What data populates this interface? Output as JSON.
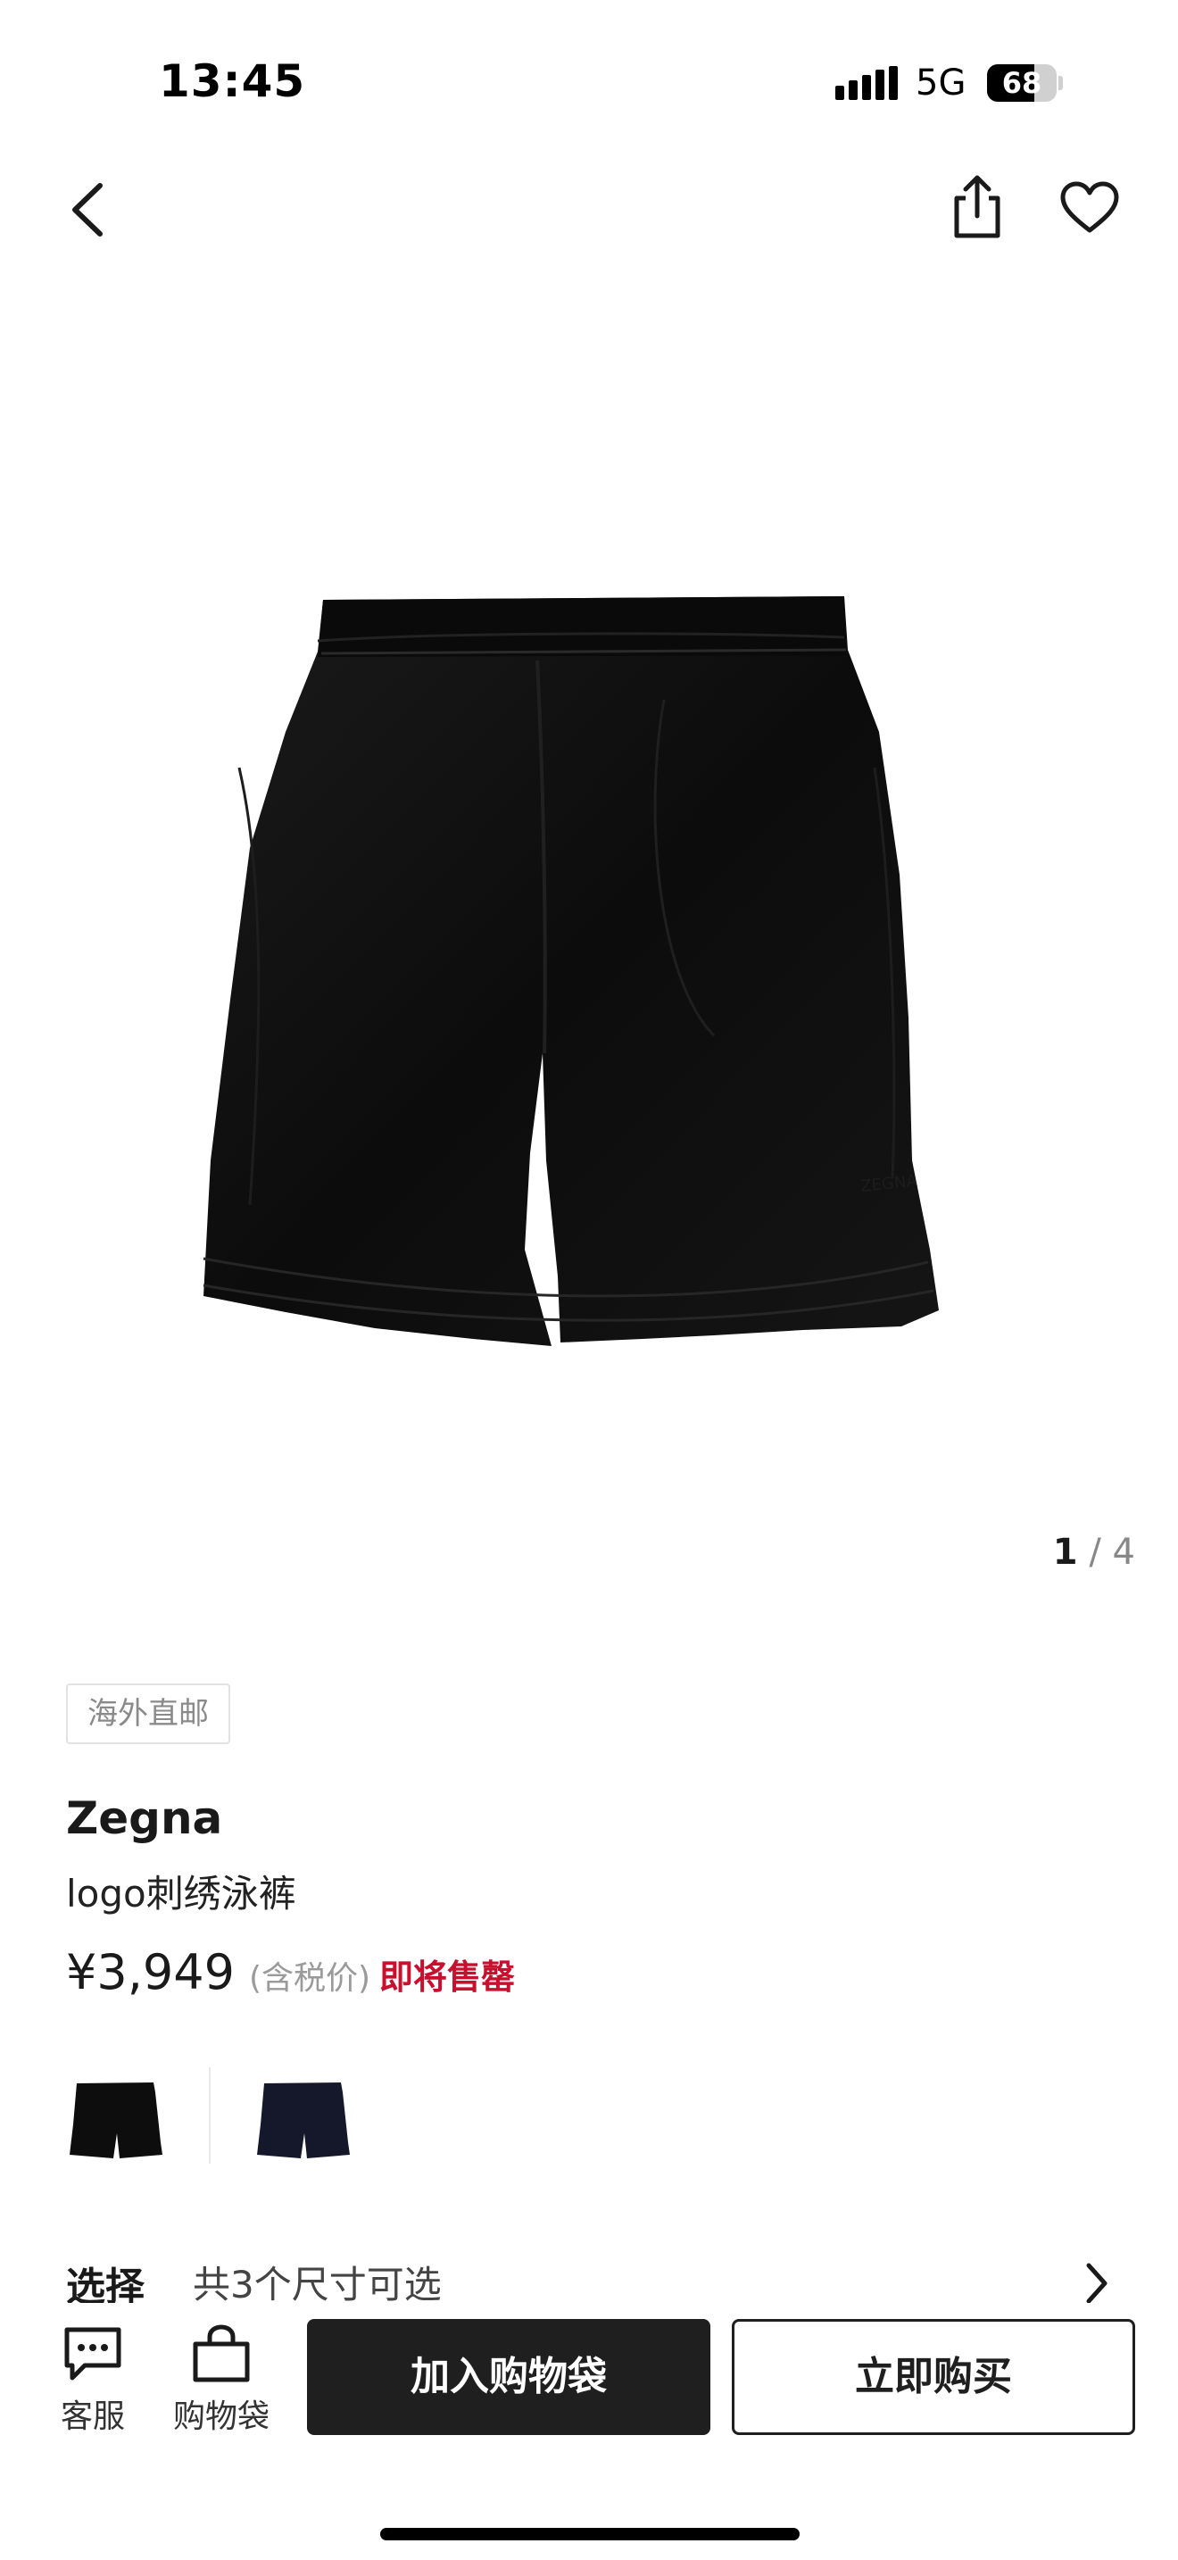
{
  "status_bar": {
    "time": "13:45",
    "network": "5G",
    "battery_level": "68"
  },
  "nav": {
    "back_icon": "chevron-left-icon",
    "share_icon": "share-icon",
    "favorite_icon": "heart-icon"
  },
  "gallery": {
    "image_subject": "black swim shorts",
    "current": "1",
    "separator": "/",
    "total": "4"
  },
  "product": {
    "badge": "海外直邮",
    "brand": "Zegna",
    "name": "logo刺绣泳裤",
    "price": "¥3,949",
    "tax_note": "(含税价)",
    "stock_note": "即将售罄",
    "colors": {
      "stock_note": "#c8102e"
    }
  },
  "variants": [
    {
      "color_name": "black",
      "hex": "#0d0d0d"
    },
    {
      "color_name": "navy",
      "hex": "#15182a"
    }
  ],
  "selection": {
    "label": "选择",
    "info": "共3个尺寸可选"
  },
  "bottom_bar": {
    "service_label": "客服",
    "service_icon": "chat-icon",
    "bag_label": "购物袋",
    "bag_icon": "shopping-bag-icon",
    "add_to_cart": "加入购物袋",
    "buy_now": "立即购买"
  }
}
